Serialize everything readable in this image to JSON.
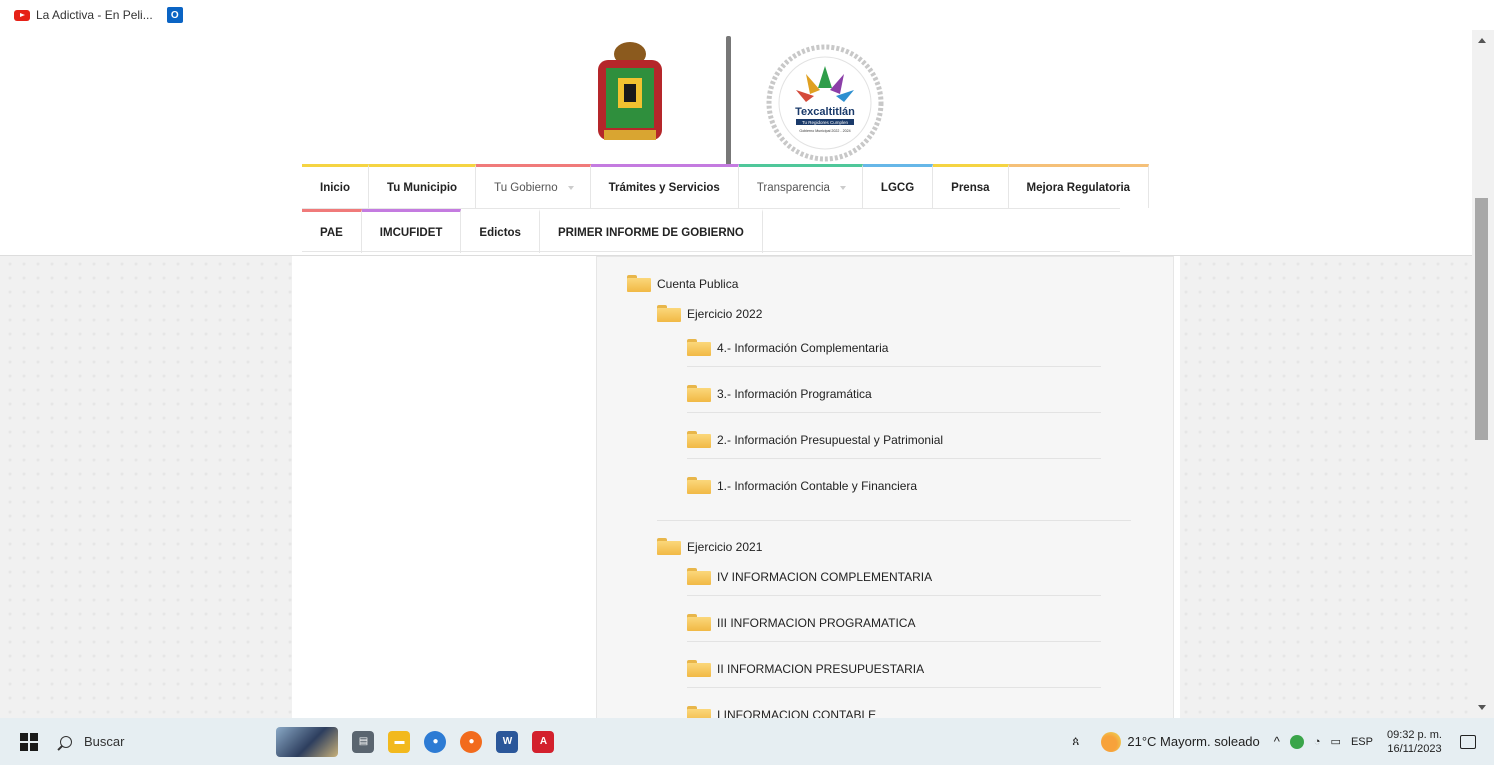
{
  "bookmarks": [
    {
      "label": "La Adictiva - En Peli...",
      "icon": "youtube-icon"
    },
    {
      "label": "",
      "icon": "outlook-icon"
    }
  ],
  "header": {
    "logo_left": "edomex-coat-of-arms-logo",
    "logo_right_text": "Texcaltitlán",
    "logo_right_sub": "Tu Regidores Cumplen",
    "logo_right_small": "Gobierno Municipal 2022 - 2024"
  },
  "nav": {
    "row1": [
      {
        "label": "Inicio",
        "accent": "#f5d442"
      },
      {
        "label": "Tu Municipio",
        "accent": "#f5d442"
      },
      {
        "label": "Tu Gobierno",
        "accent": "#f07a7a",
        "dropdown": true
      },
      {
        "label": "Trámites y Servicios",
        "accent": "#c47be0"
      },
      {
        "label": "Transparencia",
        "accent": "#4fc79a",
        "dropdown": true
      },
      {
        "label": "LGCG",
        "accent": "#66b7e8"
      },
      {
        "label": "Prensa",
        "accent": "#f5d442"
      },
      {
        "label": "Mejora Regulatoria",
        "accent": "#f5c078"
      }
    ],
    "row2": [
      {
        "label": "PAE",
        "accent": "#f07a7a"
      },
      {
        "label": "IMCUFIDET",
        "accent": "#c47be0"
      },
      {
        "label": "Edictos",
        "accent": ""
      },
      {
        "label": "PRIMER INFORME DE GOBIERNO",
        "accent": ""
      }
    ]
  },
  "tree": {
    "root": "Cuenta Publica",
    "years": [
      {
        "label": "Ejercicio 2022",
        "items": [
          "4.- Información Complementaria",
          "3.- Información Programática",
          "2.- Información Presupuestal y Patrimonial",
          "1.- Información Contable y Financiera"
        ]
      },
      {
        "label": "Ejercicio 2021",
        "items": [
          "IV INFORMACION COMPLEMENTARIA",
          "III INFORMACION PROGRAMATICA",
          "II INFORMACION PRESUPUESTARIA",
          "I INFORMACION CONTABLE"
        ]
      }
    ]
  },
  "taskbar": {
    "search_label": "Buscar",
    "weather": "21°C  Mayorm. soleado",
    "language": "ESP",
    "time": "09:32 p. m.",
    "date": "16/11/2023"
  }
}
